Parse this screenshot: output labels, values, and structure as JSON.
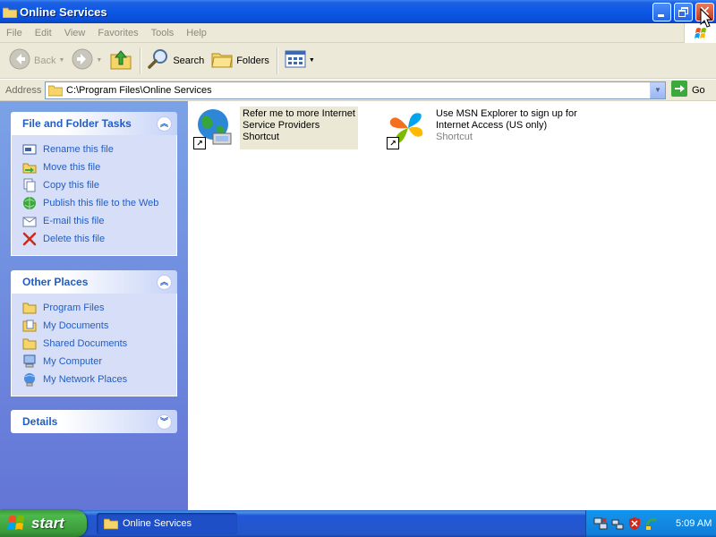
{
  "window": {
    "title": "Online Services"
  },
  "menubar": {
    "items": [
      "File",
      "Edit",
      "View",
      "Favorites",
      "Tools",
      "Help"
    ]
  },
  "toolbar": {
    "back_label": "Back",
    "search_label": "Search",
    "folders_label": "Folders"
  },
  "addressbar": {
    "label": "Address",
    "value": "C:\\Program Files\\Online Services",
    "go_label": "Go"
  },
  "file_tasks": {
    "title": "File and Folder Tasks",
    "items": [
      {
        "label": "Rename this file",
        "icon": "rename-icon"
      },
      {
        "label": "Move this file",
        "icon": "move-icon"
      },
      {
        "label": "Copy this file",
        "icon": "copy-icon"
      },
      {
        "label": "Publish this file to the Web",
        "icon": "publish-web-icon"
      },
      {
        "label": "E-mail this file",
        "icon": "email-icon"
      },
      {
        "label": "Delete this file",
        "icon": "delete-icon"
      }
    ]
  },
  "other_places": {
    "title": "Other Places",
    "items": [
      {
        "label": "Program Files",
        "icon": "folder-icon"
      },
      {
        "label": "My Documents",
        "icon": "my-documents-icon"
      },
      {
        "label": "Shared Documents",
        "icon": "folder-icon"
      },
      {
        "label": "My Computer",
        "icon": "my-computer-icon"
      },
      {
        "label": "My Network Places",
        "icon": "network-places-icon"
      }
    ]
  },
  "details": {
    "title": "Details"
  },
  "files": [
    {
      "line1": "Refer me to more Internet",
      "line2": "Service Providers",
      "type": "Shortcut",
      "icon": "internet-globe-icon",
      "selected": true
    },
    {
      "line1": "Use MSN Explorer to sign up for",
      "line2": "Internet Access (US only)",
      "type": "Shortcut",
      "icon": "msn-butterfly-icon",
      "selected": false
    }
  ],
  "taskbar": {
    "start_label": "start",
    "task_label": "Online Services",
    "clock": "5:09 AM"
  },
  "colors": {
    "title_blue": "#0a4ed6",
    "sidebar_link": "#215dc6",
    "start_green": "#3c9b3c"
  }
}
